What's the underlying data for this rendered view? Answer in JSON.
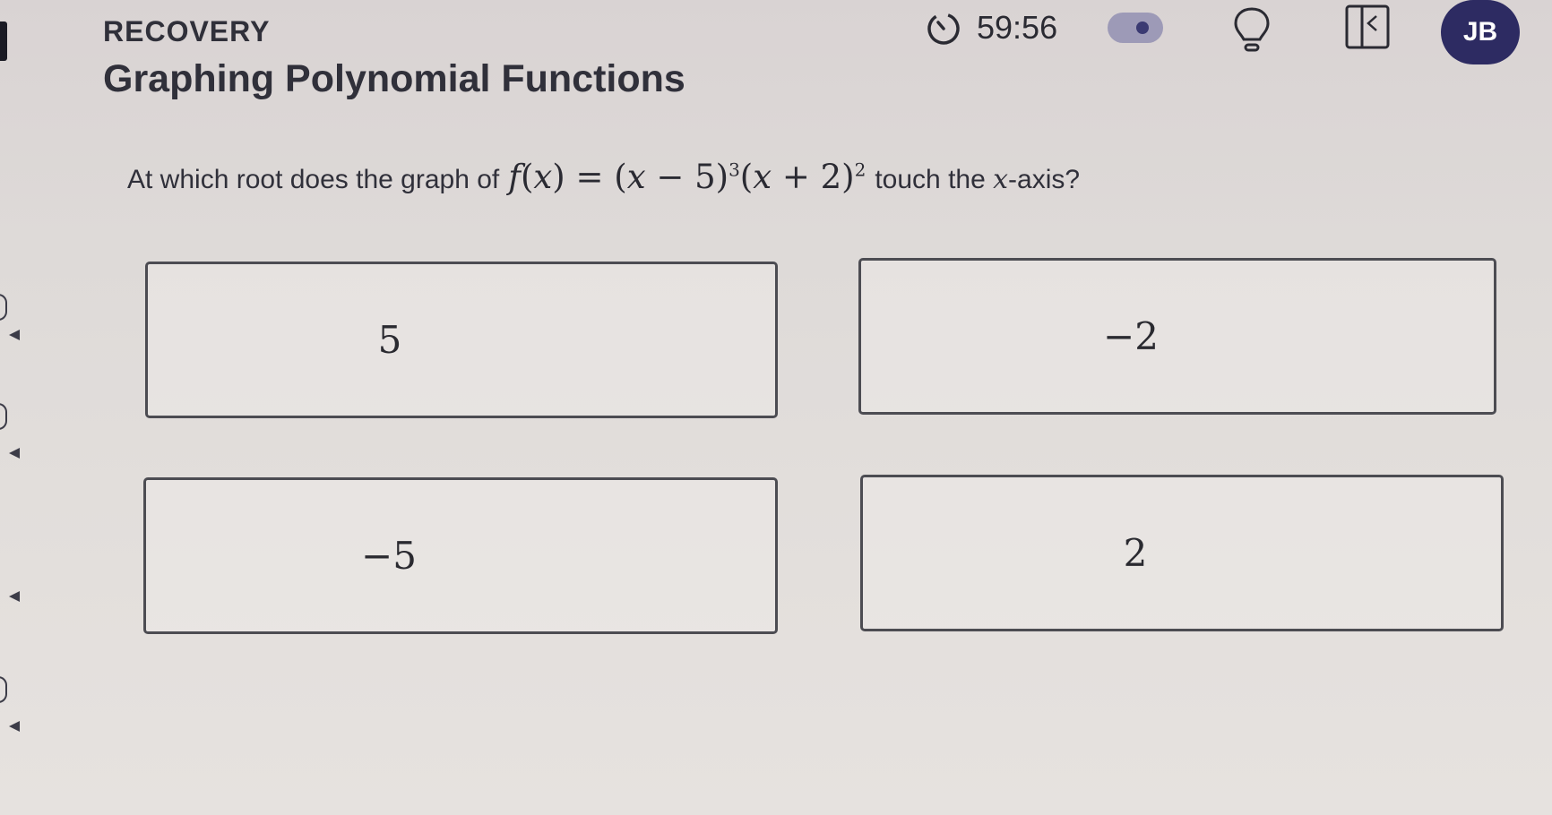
{
  "header": {
    "mode_label": "RECOVERY",
    "title": "Graphing Polynomial Functions",
    "timer": "59:56",
    "avatar_initials": "JB"
  },
  "question": {
    "prefix": "At which root does the graph of",
    "f": "f",
    "open": "(",
    "x": "x",
    "close": ") = (",
    "x2": "x",
    "minus5": " − 5)",
    "exp1": "3",
    "open2": "(",
    "x3": "x",
    "plus2": " + 2)",
    "exp2": "2",
    "suffix_before": "touch the",
    "axis_var": "x",
    "suffix_after": "-axis?"
  },
  "choices": [
    "5",
    "−2",
    "−5",
    "2"
  ],
  "colors": {
    "avatar_bg": "#2d2b62",
    "toggle_bg": "#9d9ab7",
    "toggle_knob": "#3b3a72",
    "border": "#4c4c52"
  },
  "icons": [
    "timer-icon",
    "toggle-switch",
    "lightbulb-icon",
    "calculator-icon"
  ]
}
